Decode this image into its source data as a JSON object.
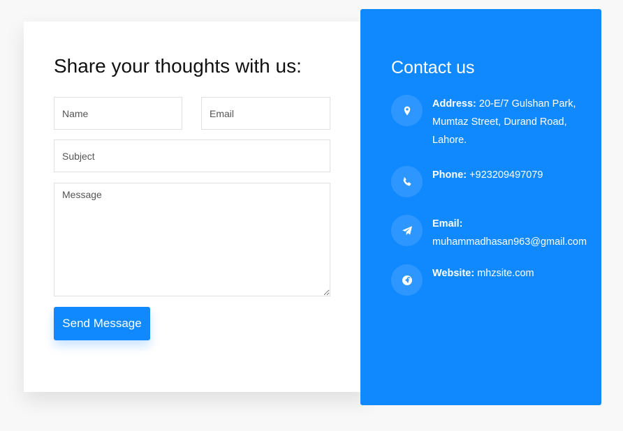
{
  "form": {
    "title": "Share your thoughts with us:",
    "name_placeholder": "Name",
    "email_placeholder": "Email",
    "subject_placeholder": "Subject",
    "message_placeholder": "Message",
    "send_label": "Send Message"
  },
  "contact": {
    "title": "Contact us",
    "address_label": "Address:",
    "address_value": "20-E/7 Gulshan Park, Mumtaz Street, Durand Road, Lahore.",
    "phone_label": "Phone:",
    "phone_value": "+923209497079",
    "email_label": "Email:",
    "email_value": "muhammadhasan963@gmail.com",
    "website_label": "Website:",
    "website_value": "mhzsite.com"
  },
  "icons": [
    "map-marker-icon",
    "phone-icon",
    "paper-plane-icon",
    "globe-icon"
  ],
  "colors": {
    "accent": "#1089ff",
    "background": "#f8f8f8",
    "card": "#ffffff"
  }
}
